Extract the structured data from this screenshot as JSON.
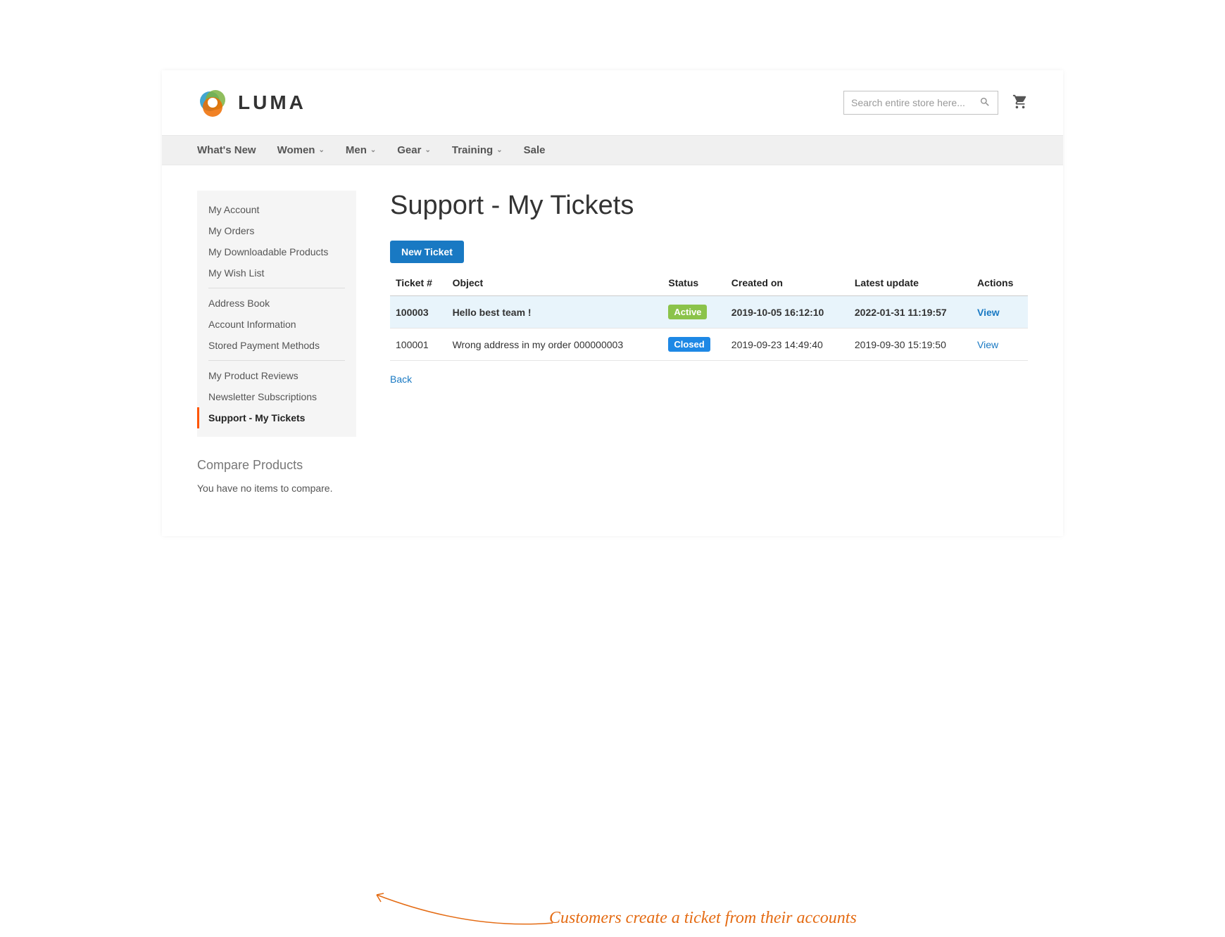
{
  "header": {
    "logo_text": "LUMA",
    "search_placeholder": "Search entire store here..."
  },
  "nav": [
    {
      "label": "What's New",
      "dropdown": false
    },
    {
      "label": "Women",
      "dropdown": true
    },
    {
      "label": "Men",
      "dropdown": true
    },
    {
      "label": "Gear",
      "dropdown": true
    },
    {
      "label": "Training",
      "dropdown": true
    },
    {
      "label": "Sale",
      "dropdown": false
    }
  ],
  "sidebar": {
    "groups": [
      [
        "My Account",
        "My Orders",
        "My Downloadable Products",
        "My Wish List"
      ],
      [
        "Address Book",
        "Account Information",
        "Stored Payment Methods"
      ],
      [
        "My Product Reviews",
        "Newsletter Subscriptions",
        "Support - My Tickets"
      ]
    ],
    "current": "Support - My Tickets",
    "compare_title": "Compare Products",
    "compare_empty": "You have no items to compare."
  },
  "main": {
    "title": "Support - My Tickets",
    "new_ticket_label": "New Ticket",
    "columns": [
      "Ticket #",
      "Object",
      "Status",
      "Created on",
      "Latest update",
      "Actions"
    ],
    "rows": [
      {
        "id": "100003",
        "object": "Hello best team !",
        "status": "Active",
        "status_class": "badge-active",
        "created": "2019-10-05 16:12:10",
        "updated": "2022-01-31 11:19:57",
        "action": "View",
        "highlight": true
      },
      {
        "id": "100001",
        "object": "Wrong address in my order 000000003",
        "status": "Closed",
        "status_class": "badge-closed",
        "created": "2019-09-23 14:49:40",
        "updated": "2019-09-30 15:19:50",
        "action": "View",
        "highlight": false
      }
    ],
    "back_label": "Back"
  },
  "annotation": {
    "text": "Customers create a ticket from their accounts"
  }
}
